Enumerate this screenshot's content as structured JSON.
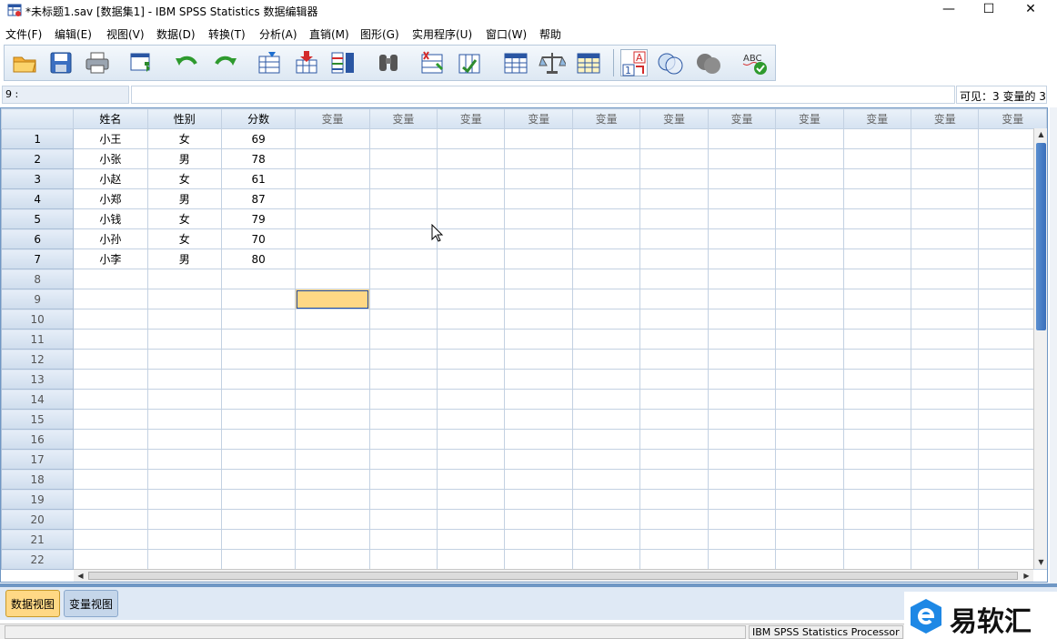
{
  "window": {
    "title": "*未标题1.sav [数据集1] - IBM SPSS Statistics 数据编辑器",
    "minimize": "—",
    "maximize": "☐",
    "close": "✕"
  },
  "menu": [
    "文件(F)",
    "编辑(E)",
    "视图(V)",
    "数据(D)",
    "转换(T)",
    "分析(A)",
    "直销(M)",
    "图形(G)",
    "实用程序(U)",
    "窗口(W)",
    "帮助"
  ],
  "toolbar": {
    "icons": [
      "open-folder-icon",
      "save-icon",
      "print-icon",
      "dialog-recall-icon",
      "undo-icon",
      "redo-icon",
      "goto-case-icon",
      "goto-variable-icon",
      "variables-icon",
      "find-icon",
      "insert-cases-icon",
      "insert-variable-icon",
      "split-file-icon",
      "weight-cases-icon",
      "select-cases-icon",
      "value-labels-icon",
      "use-variable-sets-icon",
      "show-all-variables-icon",
      "spell-check-icon"
    ]
  },
  "cellbar": {
    "cell_ref": "9 :",
    "cell_value": "",
    "visible_info": "可见：3 变量的 3"
  },
  "grid": {
    "columns": [
      "姓名",
      "性别",
      "分数",
      "变量",
      "变量",
      "变量",
      "变量",
      "变量",
      "变量",
      "变量",
      "变量",
      "变量",
      "变量",
      "变量"
    ],
    "rows": [
      {
        "n": "1",
        "cells": [
          "小王",
          "女",
          "69"
        ]
      },
      {
        "n": "2",
        "cells": [
          "小张",
          "男",
          "78"
        ]
      },
      {
        "n": "3",
        "cells": [
          "小赵",
          "女",
          "61"
        ]
      },
      {
        "n": "4",
        "cells": [
          "小郑",
          "男",
          "87"
        ]
      },
      {
        "n": "5",
        "cells": [
          "小钱",
          "女",
          "79"
        ]
      },
      {
        "n": "6",
        "cells": [
          "小孙",
          "女",
          "70"
        ]
      },
      {
        "n": "7",
        "cells": [
          "小李",
          "男",
          "80"
        ]
      },
      {
        "n": "8",
        "cells": []
      },
      {
        "n": "9",
        "cells": []
      },
      {
        "n": "10",
        "cells": []
      },
      {
        "n": "11",
        "cells": []
      },
      {
        "n": "12",
        "cells": []
      },
      {
        "n": "13",
        "cells": []
      },
      {
        "n": "14",
        "cells": []
      },
      {
        "n": "15",
        "cells": []
      },
      {
        "n": "16",
        "cells": []
      },
      {
        "n": "17",
        "cells": []
      },
      {
        "n": "18",
        "cells": []
      },
      {
        "n": "19",
        "cells": []
      },
      {
        "n": "20",
        "cells": []
      },
      {
        "n": "21",
        "cells": []
      },
      {
        "n": "22",
        "cells": []
      }
    ],
    "selected_row": 9,
    "selected_col": 4
  },
  "tabs": {
    "data_view": "数据视图",
    "variable_view": "变量视图"
  },
  "status": {
    "processor": "IBM SPSS Statistics Processor"
  },
  "watermark": {
    "text": "易软汇"
  },
  "colors": {
    "selection": "#ffd885",
    "header": "#d5e2f1",
    "border": "#6f97c4"
  }
}
